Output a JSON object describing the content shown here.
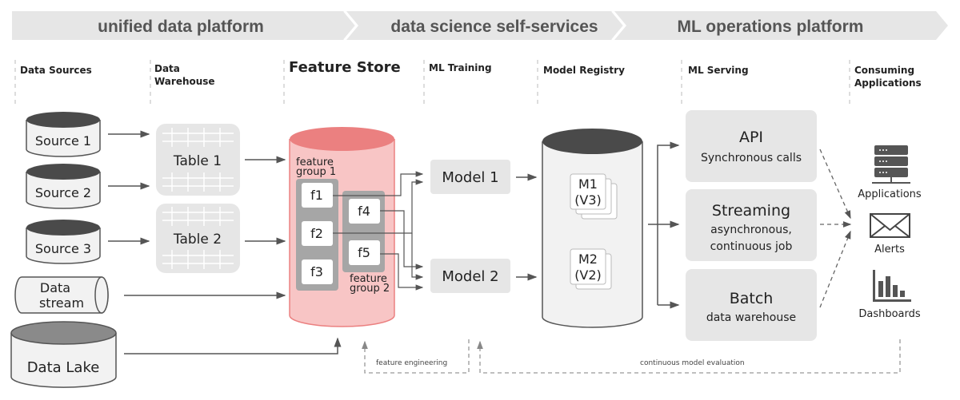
{
  "banner": [
    "unified data platform",
    "data science self-services",
    "ML operations platform"
  ],
  "columns": {
    "data_sources": "Data Sources",
    "data_warehouse": [
      "Data",
      "Warehouse"
    ],
    "feature_store": "Feature Store",
    "ml_training": "ML Training",
    "model_registry": "Model Registry",
    "ml_serving": "ML Serving",
    "consuming_applications": [
      "Consuming",
      "Applications"
    ]
  },
  "sources": [
    "Source 1",
    "Source 2",
    "Source 3"
  ],
  "data_stream": [
    "Data",
    "stream"
  ],
  "data_lake": "Data Lake",
  "tables": [
    "Table 1",
    "Table 2"
  ],
  "feature_groups": {
    "group1": [
      "feature",
      "group 1"
    ],
    "group2": [
      "feature",
      "group 2"
    ],
    "features": [
      "f1",
      "f2",
      "f3",
      "f4",
      "f5"
    ]
  },
  "models": [
    "Model 1",
    "Model 2"
  ],
  "registry": [
    [
      "M1",
      "(V3)"
    ],
    [
      "M2",
      "(V2)"
    ]
  ],
  "serving": {
    "api": {
      "title": "API",
      "sub": "Synchronous calls"
    },
    "streaming": {
      "title": "Streaming",
      "sub": [
        "asynchronous,",
        "continuous job"
      ]
    },
    "batch": {
      "title": "Batch",
      "sub": "data warehouse"
    }
  },
  "consumers": [
    {
      "label": "Applications",
      "icon": "server-icon"
    },
    {
      "label": "Alerts",
      "icon": "envelope-icon"
    },
    {
      "label": "Dashboards",
      "icon": "bar-chart-icon"
    }
  ],
  "loops": {
    "feature_engineering": "feature engineering",
    "evaluation": "continuous model evaluation"
  },
  "colors": {
    "feature_store_body": "#f8c5c5",
    "feature_store_top": "#eb8080",
    "box": "#e6e6e6",
    "cylinder_top": "#555555"
  }
}
